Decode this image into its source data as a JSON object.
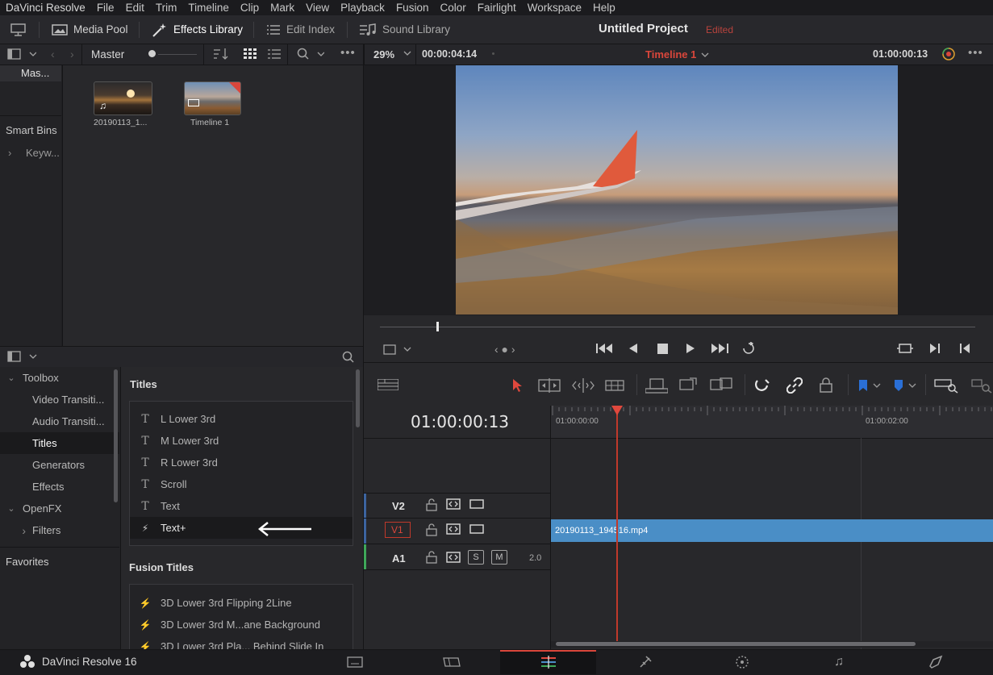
{
  "menu": [
    "DaVinci Resolve",
    "File",
    "Edit",
    "Trim",
    "Timeline",
    "Clip",
    "Mark",
    "View",
    "Playback",
    "Fusion",
    "Color",
    "Fairlight",
    "Workspace",
    "Help"
  ],
  "toolbar": {
    "media_pool": "Media Pool",
    "effects_library": "Effects Library",
    "edit_index": "Edit Index",
    "sound_library": "Sound Library",
    "project_title": "Untitled Project",
    "edited": "Edited"
  },
  "media": {
    "bin_name": "Master",
    "bins_root": "Mas...",
    "smart_bins": "Smart Bins",
    "keywords": "Keyw...",
    "clips": [
      {
        "name": "20190113_1...",
        "badge_icon": "music-note-icon"
      },
      {
        "name": "Timeline 1",
        "badge_icon": "timeline-icon"
      }
    ]
  },
  "viewer": {
    "zoom": "29%",
    "duration": "00:00:04:14",
    "timeline_name": "Timeline 1",
    "timecode": "01:00:00:13"
  },
  "effects": {
    "tree": [
      {
        "label": "Toolbox",
        "level": 0,
        "expanded": true
      },
      {
        "label": "Video Transiti...",
        "level": 1
      },
      {
        "label": "Audio Transiti...",
        "level": 1
      },
      {
        "label": "Titles",
        "level": 1,
        "selected": true
      },
      {
        "label": "Generators",
        "level": 1
      },
      {
        "label": "Effects",
        "level": 1
      },
      {
        "label": "OpenFX",
        "level": 0,
        "expanded": true
      },
      {
        "label": "Filters",
        "level": 1,
        "collapsed": true
      }
    ],
    "favorites": "Favorites",
    "titles_header": "Titles",
    "titles": [
      {
        "label": "L Lower 3rd",
        "icon": "T"
      },
      {
        "label": "M Lower 3rd",
        "icon": "T"
      },
      {
        "label": "R Lower 3rd",
        "icon": "T"
      },
      {
        "label": "Scroll",
        "icon": "T"
      },
      {
        "label": "Text",
        "icon": "T"
      },
      {
        "label": "Text+",
        "icon": "⚡",
        "highlighted": true
      }
    ],
    "fusion_header": "Fusion Titles",
    "fusion_titles": [
      {
        "label": "3D Lower 3rd Flipping 2Line"
      },
      {
        "label": "3D Lower 3rd M...ane Background"
      },
      {
        "label": "3D Lower 3rd Pla... Behind Slide In"
      }
    ]
  },
  "timeline": {
    "timecode": "01:00:00:13",
    "ruler": [
      "01:00:00:00",
      "01:00:02:00"
    ],
    "tracks": [
      {
        "name": "V2"
      },
      {
        "name": "V1",
        "active": true
      },
      {
        "name": "A1",
        "solo": "S",
        "mute": "M",
        "level": "2.0"
      }
    ],
    "clip_name": "20190113_194516.mp4"
  },
  "footer": {
    "app_name": "DaVinci Resolve 16"
  },
  "colors": {
    "accent_red": "#d9463b",
    "clip_blue": "#4a8ec6",
    "track_green": "#3fa85a"
  }
}
